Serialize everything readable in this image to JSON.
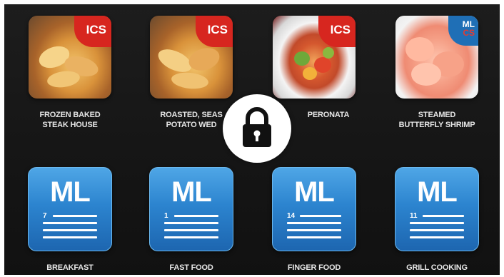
{
  "programs": [
    {
      "label_lines": [
        "FROZEN BAKED",
        "STEAK HOUSE"
      ],
      "badge": "ICS",
      "image": "fries-icon"
    },
    {
      "label_lines": [
        "ROASTED, SEAS",
        "POTATO WED"
      ],
      "badge": "ICS",
      "image": "potato-wedges-icon"
    },
    {
      "label_lines": [
        "PERONATA"
      ],
      "badge": "ICS",
      "image": "ratatouille-icon"
    },
    {
      "label_lines": [
        "STEAMED",
        "BUTTERFLY SHRIMP"
      ],
      "badge_top": "ML",
      "badge_bottom": "CS",
      "image": "shrimp-icon"
    }
  ],
  "categories": [
    {
      "title": "ML",
      "count": "7",
      "label": "BREAKFAST"
    },
    {
      "title": "ML",
      "count": "1",
      "label": "FAST FOOD"
    },
    {
      "title": "ML",
      "count": "14",
      "label": "FINGER FOOD"
    },
    {
      "title": "ML",
      "count": "11",
      "label": "GRILL COOKING"
    }
  ],
  "lock": {
    "icon": "lock-icon"
  },
  "colors": {
    "ics_red": "#d7261f",
    "ml_blue": "#2c84cf",
    "background": "#151515"
  }
}
